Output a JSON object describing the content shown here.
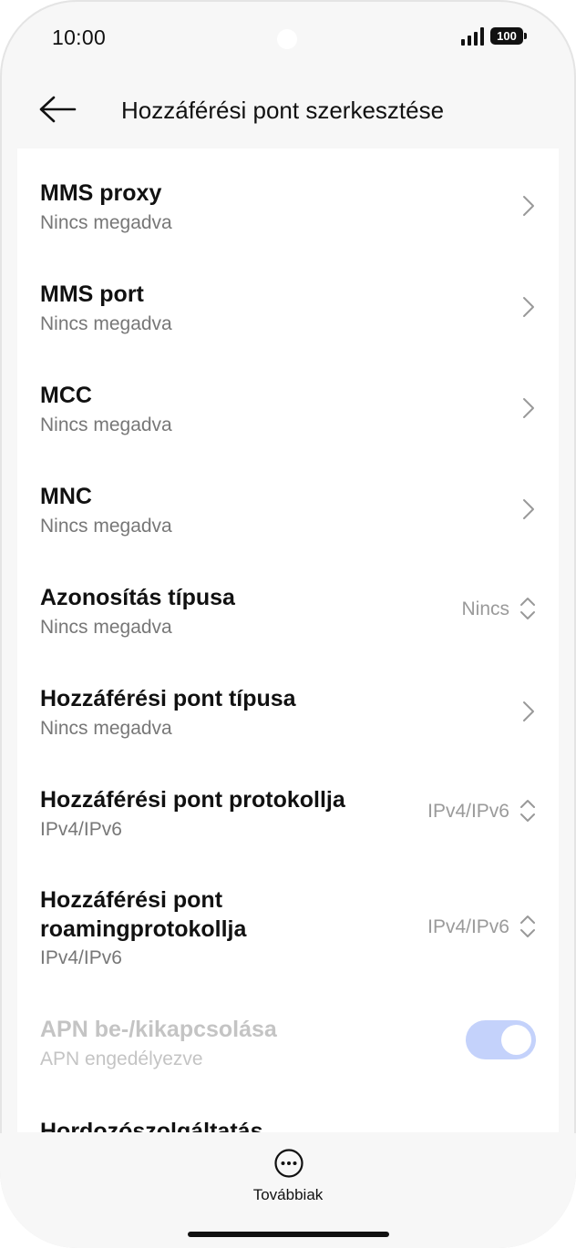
{
  "status_bar": {
    "time": "10:00",
    "battery": "100"
  },
  "header": {
    "title": "Hozzáférési pont szerkesztése"
  },
  "settings": {
    "mms_proxy": {
      "title": "MMS proxy",
      "subtitle": "Nincs megadva"
    },
    "mms_port": {
      "title": "MMS port",
      "subtitle": "Nincs megadva"
    },
    "mcc": {
      "title": "MCC",
      "subtitle": "Nincs megadva"
    },
    "mnc": {
      "title": "MNC",
      "subtitle": "Nincs megadva"
    },
    "auth_type": {
      "title": "Azonosítás típusa",
      "subtitle": "Nincs megadva",
      "value": "Nincs"
    },
    "apn_type": {
      "title": "Hozzáférési pont típusa",
      "subtitle": "Nincs megadva"
    },
    "apn_protocol": {
      "title": "Hozzáférési pont protokollja",
      "subtitle": "IPv4/IPv6",
      "value": "IPv4/IPv6"
    },
    "apn_roaming_protocol": {
      "title": "Hozzáférési pont roamingprotokollja",
      "subtitle": "IPv4/IPv6",
      "value": "IPv4/IPv6"
    },
    "apn_enable": {
      "title": "APN be-/kikapcsolása",
      "subtitle": "APN engedélyezve",
      "enabled": true
    },
    "bearer": {
      "title": "Hordozószolgáltatás"
    }
  },
  "bottom_bar": {
    "more_label": "Továbbiak"
  },
  "colors": {
    "toggle_track": "#c4d2fb",
    "background": "#f7f7f7",
    "card": "#ffffff"
  },
  "icons": {
    "back": "arrow-left-icon",
    "chevron": "chevron-right-icon",
    "updown": "chevron-up-down-icon",
    "more": "more-horizontal-icon"
  }
}
